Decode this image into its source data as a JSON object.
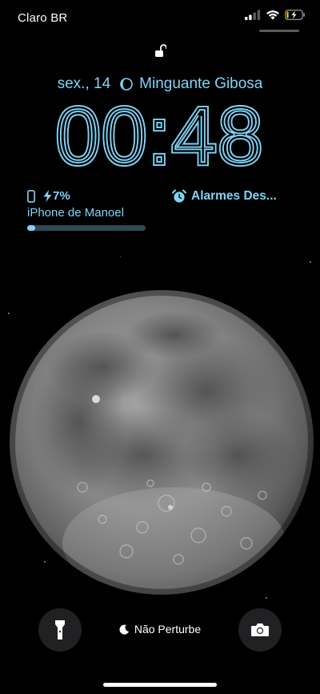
{
  "status_bar": {
    "carrier": "Claro BR",
    "icons": [
      "signal-icon",
      "wifi-icon",
      "battery-charging-icon"
    ]
  },
  "lock": {
    "icon": "unlocked-padlock-icon"
  },
  "date_widget": {
    "date": "sex., 14",
    "moon_icon": "moon-phase-icon",
    "moon_phase": "Minguante Gibosa"
  },
  "clock": {
    "time": "00:48"
  },
  "battery_widget": {
    "icon": "phone-icon",
    "percent": "7%",
    "device": "iPhone de Manoel",
    "level": 0.07
  },
  "alarm_widget": {
    "icon": "alarm-clock-icon",
    "label": "Alarmes Des..."
  },
  "bottom": {
    "flashlight_icon": "flashlight-icon",
    "focus_icon": "moon-icon",
    "focus_label": "Não Perturbe",
    "camera_icon": "camera-icon"
  },
  "colors": {
    "accent": "#7fd4f7",
    "background": "#000000"
  }
}
